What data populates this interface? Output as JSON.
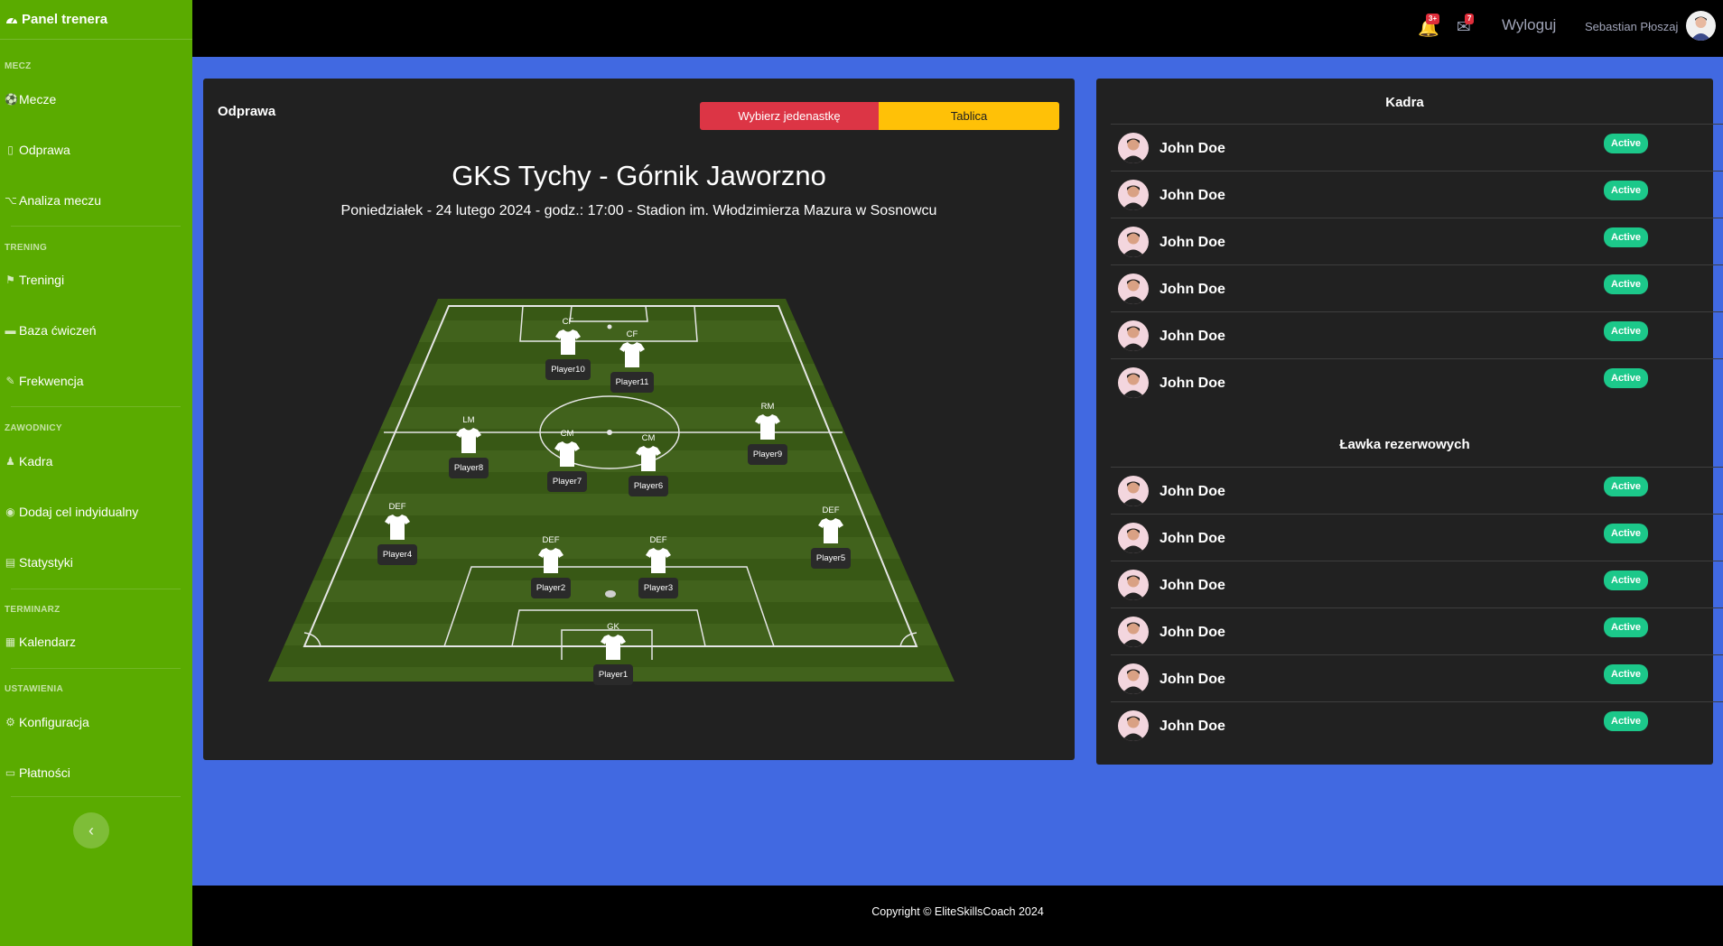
{
  "sidebar": {
    "brand": "Panel trenera",
    "sections": [
      {
        "title": "MECZ",
        "items": [
          "Mecze",
          "Odprawa",
          "Analiza meczu"
        ]
      },
      {
        "title": "TRENING",
        "items": [
          "Treningi",
          "Baza ćwiczeń",
          "Frekwencja"
        ]
      },
      {
        "title": "ZAWODNICY",
        "items": [
          "Kadra",
          "Dodaj cel indyidualny",
          "Statystyki"
        ]
      },
      {
        "title": "TERMINARZ",
        "items": [
          "Kalendarz"
        ]
      },
      {
        "title": "USTAWIENIA",
        "items": [
          "Konfiguracja",
          "Płatności"
        ]
      }
    ],
    "collapse_icon": "chevron-left-icon"
  },
  "topbar": {
    "alerts_badge": "3+",
    "messages_badge": "7",
    "logout_label": "Wyloguj",
    "user_name": "Sebastian Płoszaj"
  },
  "briefing": {
    "title": "Odprawa",
    "btn_lineup": "Wybierz jedenastkę",
    "btn_board": "Tablica",
    "match_title": "GKS Tychy - Górnik Jaworzno",
    "match_info": "Poniedziałek - 24 lutego 2024 - godz.: 17:00 - Stadion im. Włodzimierza Mazura w Sosnowcu",
    "players": [
      {
        "pos": "CF",
        "name": "Player10"
      },
      {
        "pos": "CF",
        "name": "Player11"
      },
      {
        "pos": "LM",
        "name": "Player8"
      },
      {
        "pos": "CM",
        "name": "Player7"
      },
      {
        "pos": "CM",
        "name": "Player6"
      },
      {
        "pos": "RM",
        "name": "Player9"
      },
      {
        "pos": "DEF",
        "name": "Player4"
      },
      {
        "pos": "DEF",
        "name": "Player2"
      },
      {
        "pos": "DEF",
        "name": "Player3"
      },
      {
        "pos": "DEF",
        "name": "Player5"
      },
      {
        "pos": "GK",
        "name": "Player1"
      }
    ]
  },
  "squad": {
    "title": "Kadra",
    "members": [
      {
        "name": "John Doe",
        "status": "Active"
      },
      {
        "name": "John Doe",
        "status": "Active"
      },
      {
        "name": "John Doe",
        "status": "Active"
      },
      {
        "name": "John Doe",
        "status": "Active"
      },
      {
        "name": "John Doe",
        "status": "Active"
      },
      {
        "name": "John Doe",
        "status": "Active"
      }
    ]
  },
  "bench": {
    "title": "Ławka rezerwowych",
    "members": [
      {
        "name": "John Doe",
        "status": "Active"
      },
      {
        "name": "John Doe",
        "status": "Active"
      },
      {
        "name": "John Doe",
        "status": "Active"
      },
      {
        "name": "John Doe",
        "status": "Active"
      },
      {
        "name": "John Doe",
        "status": "Active"
      },
      {
        "name": "John Doe",
        "status": "Active"
      }
    ]
  },
  "footer": {
    "copyright": "Copyright © EliteSkillsCoach 2024"
  },
  "colors": {
    "sidebar": "#5aab00",
    "background": "#4169e1",
    "card": "#212121",
    "lineup_button": "#dc3545",
    "board_button": "#ffc107",
    "active_badge": "#1cc88a"
  }
}
